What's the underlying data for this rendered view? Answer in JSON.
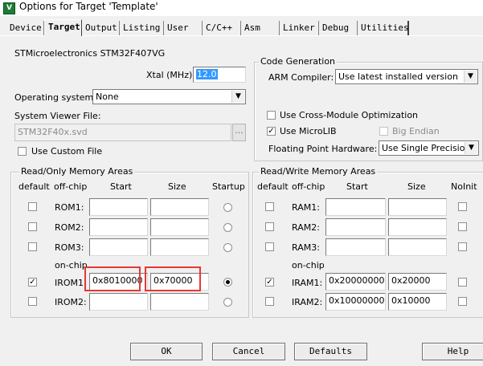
{
  "window": {
    "title": "Options for Target 'Template'",
    "icon": "uvision-app-icon"
  },
  "tabs": [
    "Device",
    "Target",
    "Output",
    "Listing",
    "User",
    "C/C++",
    "Asm",
    "Linker",
    "Debug",
    "Utilities"
  ],
  "active_tab": "Target",
  "device": {
    "name": "STMicroelectronics STM32F407VG",
    "xtal_label": "Xtal (MHz):",
    "xtal_value": "12.0",
    "os_label": "Operating system:",
    "os_value": "None",
    "svf_label": "System Viewer File:",
    "svf_value": "STM32F40x.svd",
    "browse_label": "...",
    "custom_file_label": "Use Custom File"
  },
  "code_generation": {
    "title": "Code Generation",
    "arm_compiler_label": "ARM Compiler:",
    "arm_compiler_value": "Use latest installed version",
    "cross_module_label": "Use Cross-Module Optimization",
    "microlib_label": "Use MicroLIB",
    "big_endian_label": "Big Endian",
    "fp_label": "Floating Point Hardware:",
    "fp_value": "Use Single Precision",
    "cross_module_checked": false,
    "microlib_checked": true,
    "big_endian_checked": false
  },
  "rom": {
    "title": "Read/Only Memory Areas",
    "headers": {
      "default": "default",
      "offchip": "off-chip",
      "start": "Start",
      "size": "Size",
      "startup": "Startup"
    },
    "onchip_label": "on-chip",
    "rows": [
      {
        "label": "ROM1:",
        "start": "",
        "size": "",
        "default": false,
        "startup": false
      },
      {
        "label": "ROM2:",
        "start": "",
        "size": "",
        "default": false,
        "startup": false
      },
      {
        "label": "ROM3:",
        "start": "",
        "size": "",
        "default": false,
        "startup": false
      },
      {
        "label": "IROM1:",
        "start": "0x8010000",
        "size": "0x70000",
        "default": true,
        "startup": true
      },
      {
        "label": "IROM2:",
        "start": "",
        "size": "",
        "default": false,
        "startup": false
      }
    ]
  },
  "ram": {
    "title": "Read/Write Memory Areas",
    "headers": {
      "default": "default",
      "offchip": "off-chip",
      "start": "Start",
      "size": "Size",
      "noinit": "NoInit"
    },
    "onchip_label": "on-chip",
    "rows": [
      {
        "label": "RAM1:",
        "start": "",
        "size": "",
        "default": false,
        "noinit": false
      },
      {
        "label": "RAM2:",
        "start": "",
        "size": "",
        "default": false,
        "noinit": false
      },
      {
        "label": "RAM3:",
        "start": "",
        "size": "",
        "default": false,
        "noinit": false
      },
      {
        "label": "IRAM1:",
        "start": "0x20000000",
        "size": "0x20000",
        "default": true,
        "noinit": false
      },
      {
        "label": "IRAM2:",
        "start": "0x10000000",
        "size": "0x10000",
        "default": false,
        "noinit": false
      }
    ]
  },
  "buttons": {
    "ok": "OK",
    "cancel": "Cancel",
    "defaults": "Defaults",
    "help": "Help"
  },
  "colors": {
    "highlight": "#e53935",
    "selection": "#3399ff"
  }
}
